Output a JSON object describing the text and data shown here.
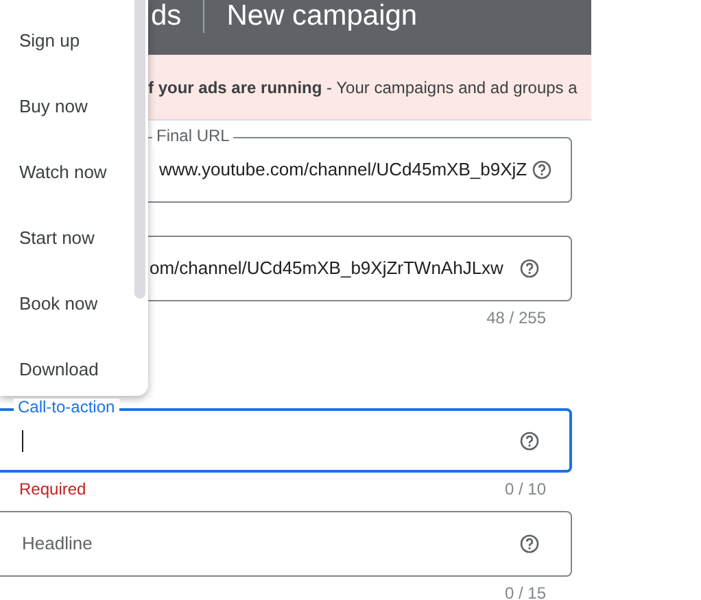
{
  "header": {
    "product_fragment": "ds",
    "title": "New campaign"
  },
  "alert": {
    "text": "**f your ads are running** - Your campaigns and ad groups a"
  },
  "menu": {
    "items": [
      {
        "label": "Sign up"
      },
      {
        "label": "Buy now"
      },
      {
        "label": "Watch now"
      },
      {
        "label": "Start now"
      },
      {
        "label": "Book now"
      },
      {
        "label": "Download"
      }
    ]
  },
  "fields": [
    {
      "label": "Final URL",
      "value": "www.youtube.com/channel/UCd45mXB_b9XjZ",
      "focused": false
    },
    {
      "value": "om/channel/UCd45mXB_b9XjZrTWnAhJLxw",
      "counter": "48 / 255",
      "focused": false
    },
    {
      "label": "Call-to-action",
      "focused": true,
      "error": "Required",
      "counter": "0 / 10"
    },
    {
      "placeholder": "Headline",
      "counter": "0 / 15",
      "focused": false
    }
  ]
}
